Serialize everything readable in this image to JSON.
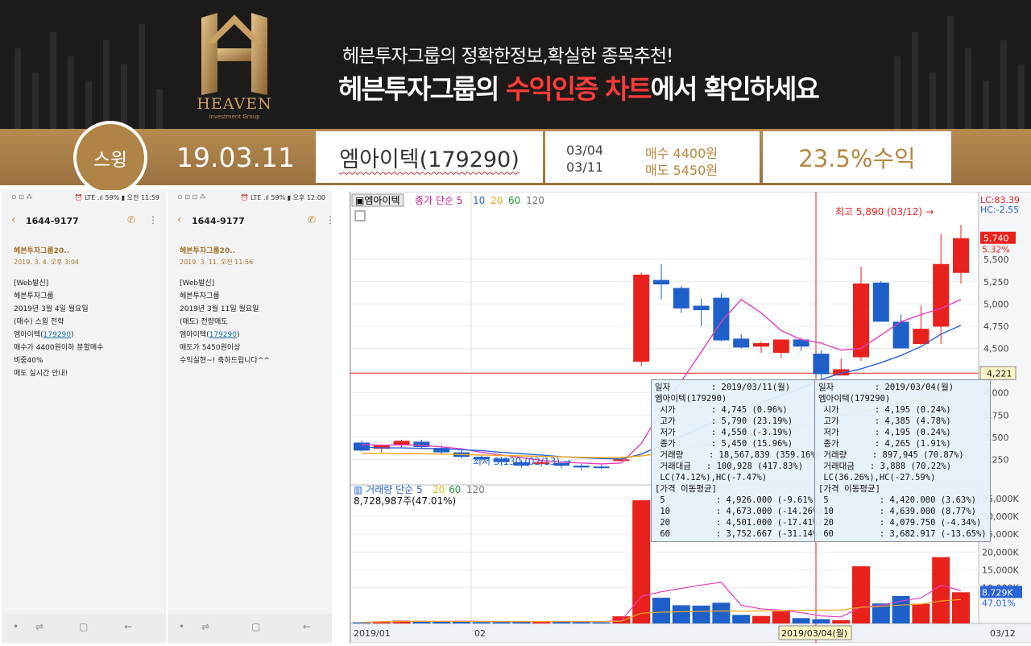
{
  "banner": {
    "logo_text": "HEAVEN",
    "logo_sub": "Investment Group",
    "slogan_line1": "헤븐투자그룹의 정확한정보,확실한 종목추천!",
    "slogan_line2_pre": "헤븐투자그룹의 ",
    "slogan_line2_highlight": "수익인증 차트",
    "slogan_line2_post": "에서 확인하세요",
    "highlight_color": "#ff3b3b",
    "gold_color": "#b68a4f"
  },
  "strip": {
    "tag": "스윙",
    "date": "19.03.11",
    "stock": "엠아이텍(179290)",
    "buy_date": "03/04",
    "sell_date": "03/11",
    "buy_text": "매수 4400원",
    "sell_text": "매도 5450원",
    "profit": "23.5%수익"
  },
  "phones": [
    {
      "status_left": "⊙ ⊡ ⁂",
      "status": "⏰ LTE .ıl 59% ▮ 오전 11:59",
      "title": "1644-9177",
      "sender": "헤븐투자그룹20..",
      "date": "2019. 3. 4. 오후 3:04",
      "lines": [
        "[Web발신]",
        "헤븐투자그룹",
        "2019년 3월 4일 월요일",
        "(매수) 스윙 전략",
        "엠아이텍(179290)",
        "매수가 4400원이하 분할매수",
        "비중40%",
        "매도 실시간 안내!"
      ]
    },
    {
      "status_left": "⊙ ⊡ ⊡ ⁂",
      "status": "⏰ LTE .ıl 59% ▮ 오후 12:00",
      "title": "1644-9177",
      "sender": "헤븐투자그룹20..",
      "date": "2019. 3. 11. 오전 11:56",
      "lines": [
        "[Web발신]",
        "헤븐투자그룹",
        "2019년 3월 11일 월요일",
        "(매도) 전량매도",
        "엠아이텍(179290)",
        "매도가 5450원이상",
        "수익실현~! 축하드립니다^^"
      ]
    }
  ],
  "chart_data": {
    "type": "candlestick",
    "title": "엠아이텍",
    "price_legend": [
      "종가 단순 5",
      "10",
      "20",
      "60",
      "120"
    ],
    "volume_legend": [
      "거래량 단순 5",
      "20",
      "60",
      "120"
    ],
    "volume_readout": "8,728,987주(47.01%)",
    "price_ylim": [
      3000,
      6100
    ],
    "price_ticks": [
      "5,500",
      "5,250",
      "5,000",
      "4,750",
      "4,500",
      "4,250",
      "4,000",
      "3,750",
      "3,500",
      "3,250"
    ],
    "volume_ticks": [
      "35,000K",
      "30,000K",
      "25,000K",
      "20,000K",
      "15,000K",
      "10,000K"
    ],
    "volume_ylim": [
      0,
      37000
    ],
    "right_labels": {
      "lc": "LC:83.39",
      "hc": "HC:-2.55",
      "last": "5,740",
      "last_pct": "5.32%",
      "cross": "4,221",
      "vol": "8.729K",
      "vol_pct": "47.01%"
    },
    "x_labels": [
      "2019/01",
      "02",
      "2019/03/04(월)",
      "03/12"
    ],
    "annotations": {
      "high": "최고 5,890 (03/12) →",
      "low": "최저 3,130 (02/13) →"
    },
    "candles": [
      {
        "o": 3440,
        "h": 3460,
        "l": 3340,
        "c": 3350,
        "v": 300
      },
      {
        "o": 3370,
        "h": 3420,
        "l": 3330,
        "c": 3410,
        "v": 600
      },
      {
        "o": 3410,
        "h": 3470,
        "l": 3380,
        "c": 3460,
        "v": 800
      },
      {
        "o": 3450,
        "h": 3470,
        "l": 3380,
        "c": 3390,
        "v": 700
      },
      {
        "o": 3380,
        "h": 3410,
        "l": 3310,
        "c": 3330,
        "v": 500
      },
      {
        "o": 3330,
        "h": 3360,
        "l": 3260,
        "c": 3280,
        "v": 600
      },
      {
        "o": 3280,
        "h": 3300,
        "l": 3230,
        "c": 3250,
        "v": 400
      },
      {
        "o": 3260,
        "h": 3280,
        "l": 3200,
        "c": 3220,
        "v": 400
      },
      {
        "o": 3220,
        "h": 3240,
        "l": 3160,
        "c": 3180,
        "v": 500
      },
      {
        "o": 3200,
        "h": 3240,
        "l": 3170,
        "c": 3220,
        "v": 600
      },
      {
        "o": 3210,
        "h": 3230,
        "l": 3150,
        "c": 3180,
        "v": 700
      },
      {
        "o": 3180,
        "h": 3200,
        "l": 3130,
        "c": 3160,
        "v": 400
      },
      {
        "o": 3170,
        "h": 3190,
        "l": 3140,
        "c": 3160,
        "v": 300
      },
      {
        "o": 3250,
        "h": 3260,
        "l": 3240,
        "c": 3250,
        "v": 2000
      },
      {
        "o": 4350,
        "h": 5350,
        "l": 4300,
        "c": 5330,
        "v": 34500
      },
      {
        "o": 5270,
        "h": 5450,
        "l": 5050,
        "c": 5220,
        "v": 7200
      },
      {
        "o": 5180,
        "h": 5200,
        "l": 4900,
        "c": 4950,
        "v": 5100
      },
      {
        "o": 4980,
        "h": 5060,
        "l": 4750,
        "c": 4930,
        "v": 5000
      },
      {
        "o": 5070,
        "h": 5120,
        "l": 4580,
        "c": 4590,
        "v": 5800
      },
      {
        "o": 4610,
        "h": 4660,
        "l": 4500,
        "c": 4510,
        "v": 2400
      },
      {
        "o": 4520,
        "h": 4580,
        "l": 4450,
        "c": 4560,
        "v": 2100
      },
      {
        "o": 4450,
        "h": 4600,
        "l": 4390,
        "c": 4600,
        "v": 3400
      },
      {
        "o": 4600,
        "h": 4620,
        "l": 4470,
        "c": 4520,
        "v": 1500
      },
      {
        "o": 4440,
        "h": 4480,
        "l": 4150,
        "c": 4210,
        "v": 1200
      },
      {
        "o": 4195,
        "h": 4385,
        "l": 4195,
        "c": 4265,
        "v": 898
      },
      {
        "o": 4400,
        "h": 5420,
        "l": 4360,
        "c": 5230,
        "v": 16000
      },
      {
        "o": 5240,
        "h": 5260,
        "l": 4900,
        "c": 4800,
        "v": 5600
      },
      {
        "o": 4800,
        "h": 4880,
        "l": 4580,
        "c": 4500,
        "v": 7700
      },
      {
        "o": 4550,
        "h": 4980,
        "l": 4540,
        "c": 4720,
        "v": 5500
      },
      {
        "o": 4745,
        "h": 5790,
        "l": 4550,
        "c": 5450,
        "v": 18568
      },
      {
        "o": 5350,
        "h": 5890,
        "l": 5230,
        "c": 5740,
        "v": 8729
      }
    ],
    "ma5": [
      3420,
      3410,
      3415,
      3410,
      3390,
      3370,
      3330,
      3300,
      3270,
      3240,
      3220,
      3210,
      3200,
      3210,
      3430,
      3800,
      4130,
      4460,
      4800,
      5050,
      4900,
      4700,
      4600,
      4560,
      4480,
      4500,
      4650,
      4800,
      4880,
      4950,
      5050
    ],
    "ma20": [
      3390,
      3380,
      3380,
      3375,
      3370,
      3360,
      3350,
      3330,
      3315,
      3300,
      3280,
      3270,
      3260,
      3255,
      3310,
      3410,
      3510,
      3610,
      3700,
      3800,
      3890,
      3970,
      4050,
      4150,
      4220,
      4270,
      4340,
      4420,
      4520,
      4660,
      4760
    ],
    "ma60": [
      3320,
      3320,
      3315,
      3315,
      3310,
      3305,
      3300,
      3295,
      3290,
      3285,
      3280,
      3275,
      3272,
      3272,
      3290,
      3320,
      3360,
      3400,
      3440,
      3490,
      3540,
      3590,
      3640,
      3690,
      3740,
      3780,
      3830,
      3880,
      3930,
      4000,
      4080
    ],
    "tooltip_left": [
      "일자        : 2019/03/11(월)",
      "엠아이텍(179290)",
      " 시가       : 4,745 (0.96%)",
      " 고가       : 5,790 (23.19%)",
      " 저가       : 4,550 (-3.19%)",
      " 종가       : 5,450 (15.96%)",
      " 거래량     : 18,567,839 (359.16%)",
      " 거래대금   : 100,928 (417.83%)",
      " LC(74.12%),HC(-7.47%)",
      "[가격 이동평균]",
      " 5          : 4,926.000 (-9.61%)",
      " 10         : 4,673.000 (-14.26%)",
      " 20         : 4,501.000 (-17.41%)",
      " 60         : 3,752.667 (-31.14%)"
    ],
    "tooltip_right": [
      "일자        : 2019/03/04(월)",
      "엠아이텍(179290)",
      " 시가       : 4,195 (0.24%)",
      " 고가       : 4,385 (4.78%)",
      " 저가       : 4,195 (0.24%)",
      " 종가       : 4,265 (1.91%)",
      " 거래량     : 897,945 (70.87%)",
      " 거래대금   : 3,888 (70.22%)",
      " LC(36.26%),HC(-27.59%)",
      "[가격 이동평균]",
      " 5          : 4,420.000 (3.63%)",
      " 10         : 4,639.000 (8.77%)",
      " 20         : 4,079.750 (-4.34%)",
      " 60         : 3,682.917 (-13.65%)"
    ],
    "up_color": "#e8211c",
    "down_color": "#1e5fc9"
  }
}
